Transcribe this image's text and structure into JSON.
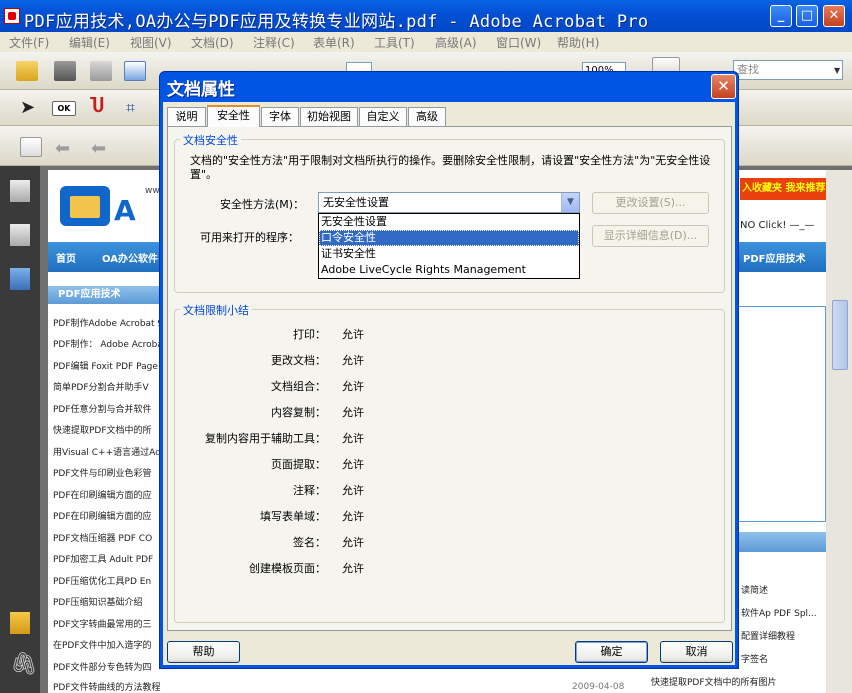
{
  "app": {
    "title": "PDF应用技术,OA办公与PDF应用及转换专业网站.pdf - Adobe Acrobat Pro",
    "min": "_",
    "max": "□",
    "close": "✕"
  },
  "menu": [
    "文件(F)",
    "编辑(E)",
    "视图(V)",
    "文档(D)",
    "注释(C)",
    "表单(R)",
    "工具(T)",
    "高级(A)",
    "窗口(W)",
    "帮助(H)"
  ],
  "toolbar": {
    "zoom": "100%",
    "search_placeholder": "查找",
    "ok_label": "OK"
  },
  "background_page": {
    "nav": [
      "首页",
      "OA办公软件",
      "PDF应用技术"
    ],
    "category": "PDF应用技术",
    "banner": "入收藏夹 我来推荐",
    "click_text": "NO Click! —_—",
    "site_logo_letter": "A",
    "domain_fragment": "ww",
    "articles": [
      "PDF制作Adobe Acrobat 9",
      "PDF制作： Adobe Acroba",
      "PDF编辑 Foxit PDF Page",
      "简单PDF分割合并助手V",
      "PDF任意分割与合并软件",
      "快速提取PDF文档中的所",
      "用Visual C++语言通过Ad",
      "PDF文件与印刷业色彩管",
      "PDF在印刷编辑方面的应",
      "PDF在印刷编辑方面的应",
      "PDF文档压缩器 PDF CO",
      "PDF加密工具 Adult PDF",
      "PDF压缩优化工具PD En",
      "PDF压缩知识基础介绍",
      "PDF文字转曲最常用的三",
      "在PDF文件中加入造字的",
      "PDF文件部分专色转为四",
      "PDF文件转曲线的方法教程"
    ],
    "right_links": [
      "读简述",
      "软件Ap PDF Spl...",
      "配置详细教程",
      "字签名",
      "快速提取PDF文档中的所有图片"
    ],
    "date": "2009-04-08"
  },
  "dialog": {
    "title": "文档属性",
    "close": "✕",
    "tabs": [
      "说明",
      "安全性",
      "字体",
      "初始视图",
      "自定义",
      "高级"
    ],
    "active_tab": "安全性",
    "security_group": "文档安全性",
    "description": "文档的\"安全性方法\"用于限制对文档所执行的操作。要删除安全性限制，请设置\"安全性方法\"为\"无安全性设置\"。",
    "method_label": "安全性方法(M)：",
    "method_value": "无安全性设置",
    "change_settings": "更改设置(S)...",
    "can_open_label": "可用来打开的程序：",
    "show_details": "显示详细信息(D)...",
    "dropdown_options": [
      "无安全性设置",
      "口令安全性",
      "证书安全性",
      "Adobe LiveCycle Rights Management"
    ],
    "selected_option": "口令安全性",
    "restrictions_group": "文档限制小结",
    "restrictions": [
      {
        "label": "打印：",
        "value": "允许"
      },
      {
        "label": "更改文档：",
        "value": "允许"
      },
      {
        "label": "文档组合：",
        "value": "允许"
      },
      {
        "label": "内容复制：",
        "value": "允许"
      },
      {
        "label": "复制内容用于辅助工具：",
        "value": "允许"
      },
      {
        "label": "页面提取：",
        "value": "允许"
      },
      {
        "label": "注释：",
        "value": "允许"
      },
      {
        "label": "填写表单域：",
        "value": "允许"
      },
      {
        "label": "签名：",
        "value": "允许"
      },
      {
        "label": "创建模板页面：",
        "value": "允许"
      }
    ],
    "help": "帮助",
    "ok": "确定",
    "cancel": "取消"
  },
  "colors": {
    "xp_blue": "#0055e5",
    "dialog_bg": "#ece9d8",
    "selection": "#316ac5"
  }
}
